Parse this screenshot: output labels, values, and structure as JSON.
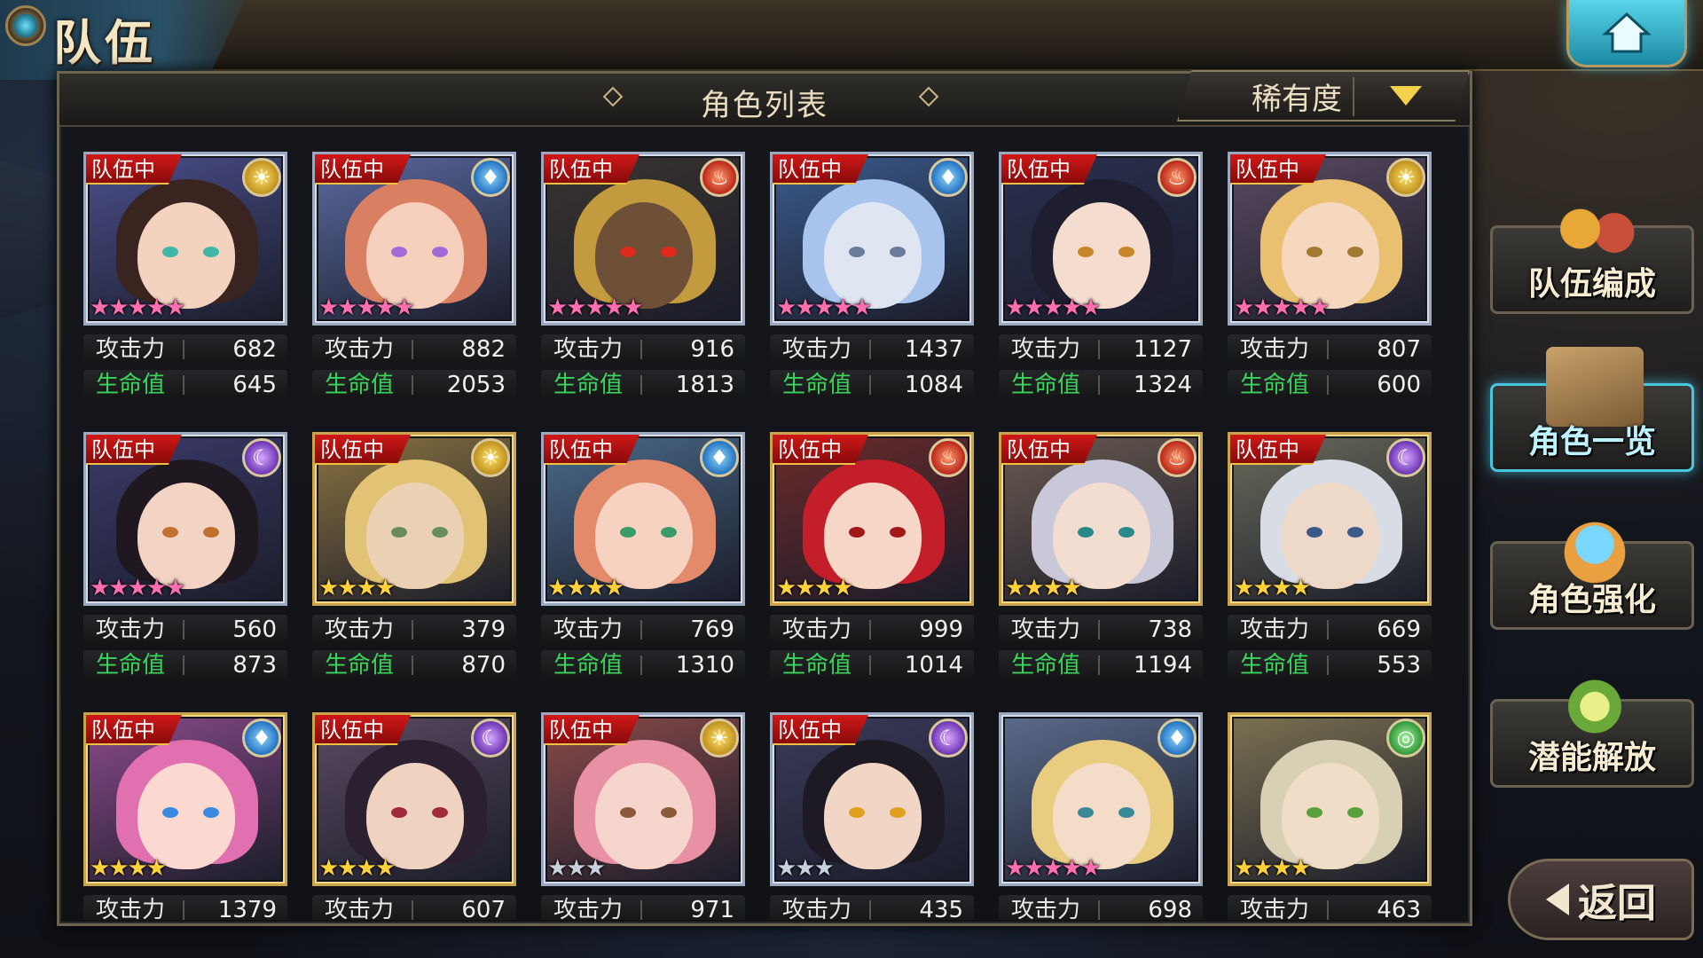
{
  "header": {
    "title": "队伍",
    "home_icon": "home-icon"
  },
  "panel": {
    "title": "角色列表",
    "sort": {
      "selected": "稀有度"
    }
  },
  "stat_labels": {
    "atk": "攻击力",
    "hp": "生命值"
  },
  "team_tag": "队伍中",
  "characters": [
    {
      "in_team": true,
      "element": "light",
      "stars": 5,
      "rarity": "rainbow",
      "frame": "silver",
      "atk": "682",
      "hp": "645",
      "skin": "#f3d2bf",
      "hair": "#3a2420",
      "eye": "#3fb6a8",
      "bg": "#4a4e8a"
    },
    {
      "in_team": true,
      "element": "water",
      "stars": 5,
      "rarity": "rainbow",
      "frame": "silver",
      "atk": "882",
      "hp": "2053",
      "skin": "#f6cfbd",
      "hair": "#d97f62",
      "eye": "#a16bd8",
      "bg": "#5a6aa0"
    },
    {
      "in_team": true,
      "element": "fire",
      "stars": 5,
      "rarity": "rainbow",
      "frame": "silver",
      "atk": "916",
      "hp": "1813",
      "skin": "#6e5038",
      "hair": "#c49a3e",
      "eye": "#e02a1e",
      "bg": "#3a3430"
    },
    {
      "in_team": true,
      "element": "water",
      "stars": 5,
      "rarity": "rainbow",
      "frame": "silver",
      "atk": "1437",
      "hp": "1084",
      "skin": "#dfe6f2",
      "hair": "#a8c4ec",
      "eye": "#6a7a9a",
      "bg": "#3a5a8c"
    },
    {
      "in_team": true,
      "element": "fire",
      "stars": 5,
      "rarity": "rainbow",
      "frame": "silver",
      "atk": "1127",
      "hp": "1324",
      "skin": "#f4dccf",
      "hair": "#1e1e30",
      "eye": "#c8862a",
      "bg": "#2a3050"
    },
    {
      "in_team": true,
      "element": "light",
      "stars": 5,
      "rarity": "rainbow",
      "frame": "silver",
      "atk": "807",
      "hp": "600",
      "skin": "#f5d8bf",
      "hair": "#e8c070",
      "eye": "#a07a30",
      "bg": "#5a4a60"
    },
    {
      "in_team": true,
      "element": "dark",
      "stars": 5,
      "rarity": "rainbow",
      "frame": "silver",
      "atk": "560",
      "hp": "873",
      "skin": "#f3d4c4",
      "hair": "#201820",
      "eye": "#c07030",
      "bg": "#3a3a6a"
    },
    {
      "in_team": true,
      "element": "light",
      "stars": 4,
      "rarity": "gold",
      "frame": "gold",
      "atk": "379",
      "hp": "870",
      "skin": "#ecd2b4",
      "hair": "#e2c274",
      "eye": "#6a8a60",
      "bg": "#8a7240"
    },
    {
      "in_team": true,
      "element": "water",
      "stars": 4,
      "rarity": "gold",
      "frame": "silver",
      "atk": "769",
      "hp": "1310",
      "skin": "#f7d2c0",
      "hair": "#e28a6a",
      "eye": "#3a9a6a",
      "bg": "#4a6a8a"
    },
    {
      "in_team": true,
      "element": "fire",
      "stars": 4,
      "rarity": "gold",
      "frame": "gold",
      "atk": "999",
      "hp": "1014",
      "skin": "#f6d6c6",
      "hair": "#c41e2a",
      "eye": "#a01818",
      "bg": "#6a2a2a"
    },
    {
      "in_team": true,
      "element": "fire",
      "stars": 4,
      "rarity": "gold",
      "frame": "gold",
      "atk": "738",
      "hp": "1194",
      "skin": "#f3dcd0",
      "hair": "#c8c8d8",
      "eye": "#2a8a8a",
      "bg": "#6a5a50"
    },
    {
      "in_team": true,
      "element": "dark",
      "stars": 4,
      "rarity": "gold",
      "frame": "gold",
      "atk": "669",
      "hp": "553",
      "skin": "#eed8c8",
      "hair": "#d8dce4",
      "eye": "#3a5a8a",
      "bg": "#6a6a5a"
    },
    {
      "in_team": true,
      "element": "water",
      "stars": 4,
      "rarity": "gold",
      "frame": "gold",
      "atk": "1379",
      "hp": "",
      "skin": "#fbd8d0",
      "hair": "#e070b0",
      "eye": "#3a8ae0",
      "bg": "#8a4a8a"
    },
    {
      "in_team": true,
      "element": "dark",
      "stars": 4,
      "rarity": "gold",
      "frame": "gold",
      "atk": "607",
      "hp": "",
      "skin": "#efd2c0",
      "hair": "#2a2030",
      "eye": "#a02a3a",
      "bg": "#5a4a60"
    },
    {
      "in_team": true,
      "element": "light",
      "stars": 3,
      "rarity": "silver",
      "frame": "silver",
      "atk": "971",
      "hp": "",
      "skin": "#f6d6cc",
      "hair": "#e890a4",
      "eye": "#8a5a3a",
      "bg": "#8a4a4a"
    },
    {
      "in_team": true,
      "element": "dark",
      "stars": 3,
      "rarity": "silver",
      "frame": "silver",
      "atk": "435",
      "hp": "",
      "skin": "#f1d6c6",
      "hair": "#1e1a24",
      "eye": "#e0a020",
      "bg": "#3a3a5a"
    },
    {
      "in_team": false,
      "element": "water",
      "stars": 5,
      "rarity": "rainbow",
      "frame": "silver",
      "atk": "698",
      "hp": "",
      "skin": "#f3dcc8",
      "hair": "#e8cc80",
      "eye": "#3a8a9a",
      "bg": "#5a6a8a"
    },
    {
      "in_team": false,
      "element": "wind",
      "stars": 4,
      "rarity": "gold",
      "frame": "gold",
      "atk": "463",
      "hp": "",
      "skin": "#efddc8",
      "hair": "#d8d0b4",
      "eye": "#5aa03a",
      "bg": "#7a7050"
    }
  ],
  "side_menu": [
    {
      "label": "队伍编成",
      "icon": "party-characters-icon",
      "active": false
    },
    {
      "label": "角色一览",
      "icon": "character-book-icon",
      "active": true
    },
    {
      "label": "角色强化",
      "icon": "crystal-upgrade-icon",
      "active": false
    },
    {
      "label": "潜能解放",
      "icon": "potential-orb-icon",
      "active": false
    }
  ],
  "back_button": {
    "label": "返回"
  },
  "colors": {
    "accent": "#48c6e0",
    "hp_label": "#3bd45a",
    "team_tag": "#d01818"
  }
}
